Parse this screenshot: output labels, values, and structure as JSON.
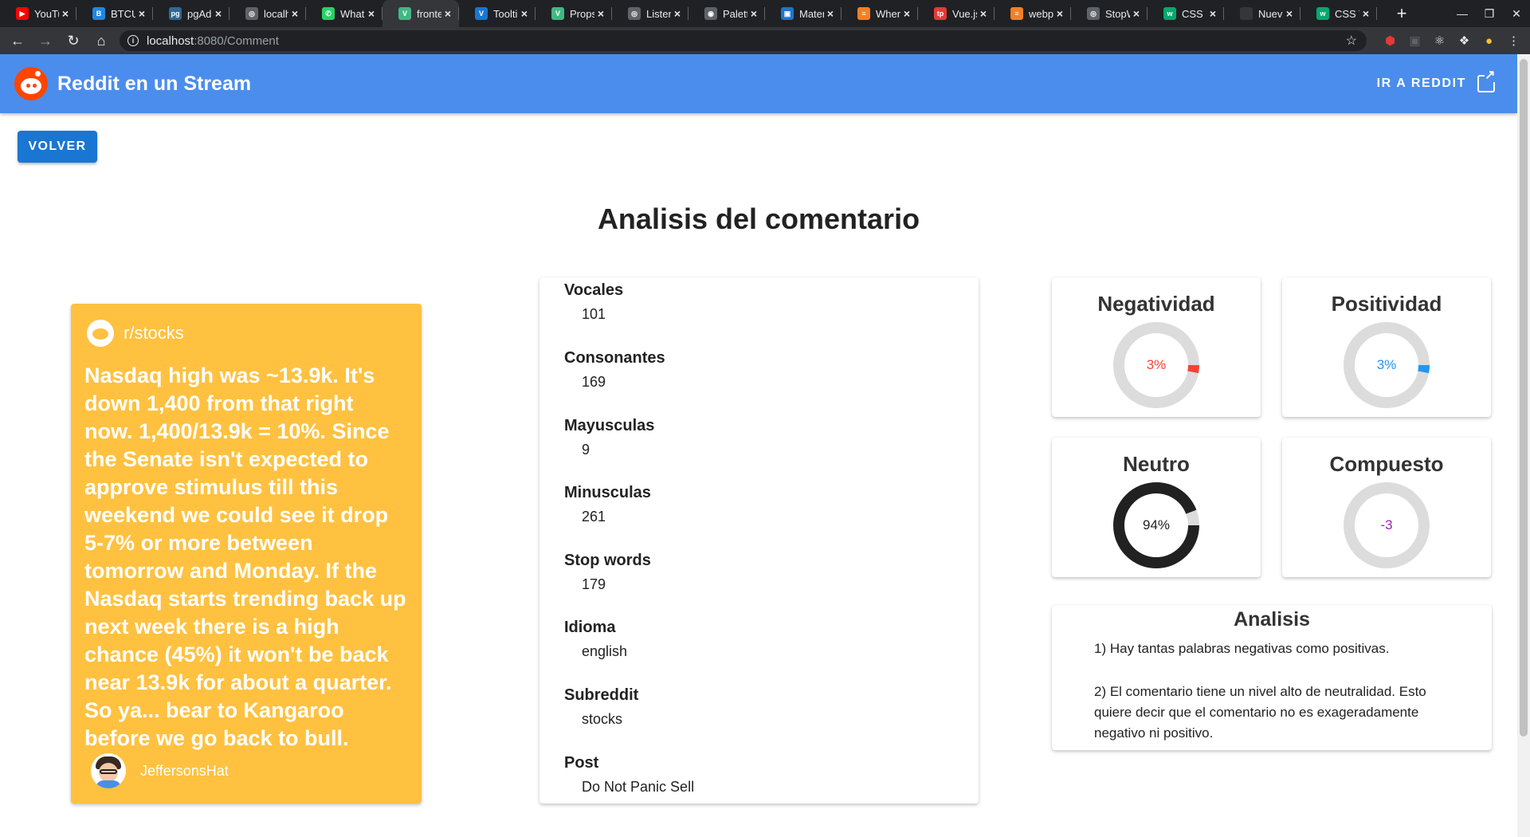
{
  "browser": {
    "tabs": [
      {
        "title": "YouTube",
        "fav_color": "#ff0000",
        "fav": "▶"
      },
      {
        "title": "BTCUSD",
        "fav_color": "#1e88e5",
        "fav": "B"
      },
      {
        "title": "pgAdmin",
        "fav_color": "#336791",
        "fav": "pg"
      },
      {
        "title": "localhost",
        "fav_color": "#5f6368",
        "fav": "◎"
      },
      {
        "title": "WhatsApp",
        "fav_color": "#25d366",
        "fav": "✆"
      },
      {
        "title": "frontend",
        "fav_color": "#41b883",
        "fav": "V"
      },
      {
        "title": "Tooltip",
        "fav_color": "#1976d2",
        "fav": "V"
      },
      {
        "title": "Props",
        "fav_color": "#41b883",
        "fav": "V"
      },
      {
        "title": "Listeners",
        "fav_color": "#5f6368",
        "fav": "◎"
      },
      {
        "title": "Palette",
        "fav_color": "#5f6368",
        "fav": "◉"
      },
      {
        "title": "Material",
        "fav_color": "#1976d2",
        "fav": "▣"
      },
      {
        "title": "When",
        "fav_color": "#f48024",
        "fav": "≡"
      },
      {
        "title": "Vue.js",
        "fav_color": "#e53935",
        "fav": "tp"
      },
      {
        "title": "webpack",
        "fav_color": "#f48024",
        "fav": "≡"
      },
      {
        "title": "StopWords",
        "fav_color": "#5f6368",
        "fav": "◎"
      },
      {
        "title": "CSS Flex",
        "fav_color": "#04aa6d",
        "fav": "w"
      },
      {
        "title": "Nueva pestaña",
        "fav_color": "#35363a",
        "fav": ""
      },
      {
        "title": "CSS Tooltip",
        "fav_color": "#04aa6d",
        "fav": "w"
      }
    ],
    "active_tab_index": 5,
    "url_host": "localhost",
    "url_path": ":8080/Comment"
  },
  "appbar": {
    "title": "Reddit en un Stream",
    "link_label": "IR A REDDIT"
  },
  "back_button": "VOLVER",
  "page_title": "Analisis del comentario",
  "post": {
    "subreddit": "r/stocks",
    "text": "Nasdaq high was ~13.9k. It's down 1,400 from that right now. 1,400/13.9k = 10%. Since the Senate isn't expected to approve stimulus till this weekend we could see it drop 5-7% or more between tomorrow and Monday. If the Nasdaq starts trending back up next week there is a high chance (45%) it won't be back near 13.9k for about a quarter. So ya... bear to Kangaroo before we go back to bull.",
    "author": "JeffersonsHat"
  },
  "stats": [
    {
      "label": "Vocales",
      "value": "101"
    },
    {
      "label": "Consonantes",
      "value": "169"
    },
    {
      "label": "Mayusculas",
      "value": "9"
    },
    {
      "label": "Minusculas",
      "value": "261"
    },
    {
      "label": "Stop words",
      "value": "179"
    },
    {
      "label": "Idioma",
      "value": "english"
    },
    {
      "label": "Subreddit",
      "value": "stocks"
    },
    {
      "label": "Post",
      "value": "Do Not Panic Sell"
    }
  ],
  "gauges": [
    {
      "title": "Negatividad",
      "text": "3%",
      "percent": 3,
      "color": "#f44336"
    },
    {
      "title": "Positividad",
      "text": "3%",
      "percent": 3,
      "color": "#2196f3"
    },
    {
      "title": "Neutro",
      "text": "94%",
      "percent": 94,
      "color": "#212121"
    },
    {
      "title": "Compuesto",
      "text": "-3",
      "percent": 0,
      "color": "#9c27b0"
    }
  ],
  "analysis": {
    "title": "Analisis",
    "points": [
      "1) Hay tantas palabras negativas como positivas.",
      "2) El comentario tiene un nivel alto de neutralidad. Esto quiere decir que el comentario no es exageradamente negativo ni positivo."
    ]
  }
}
